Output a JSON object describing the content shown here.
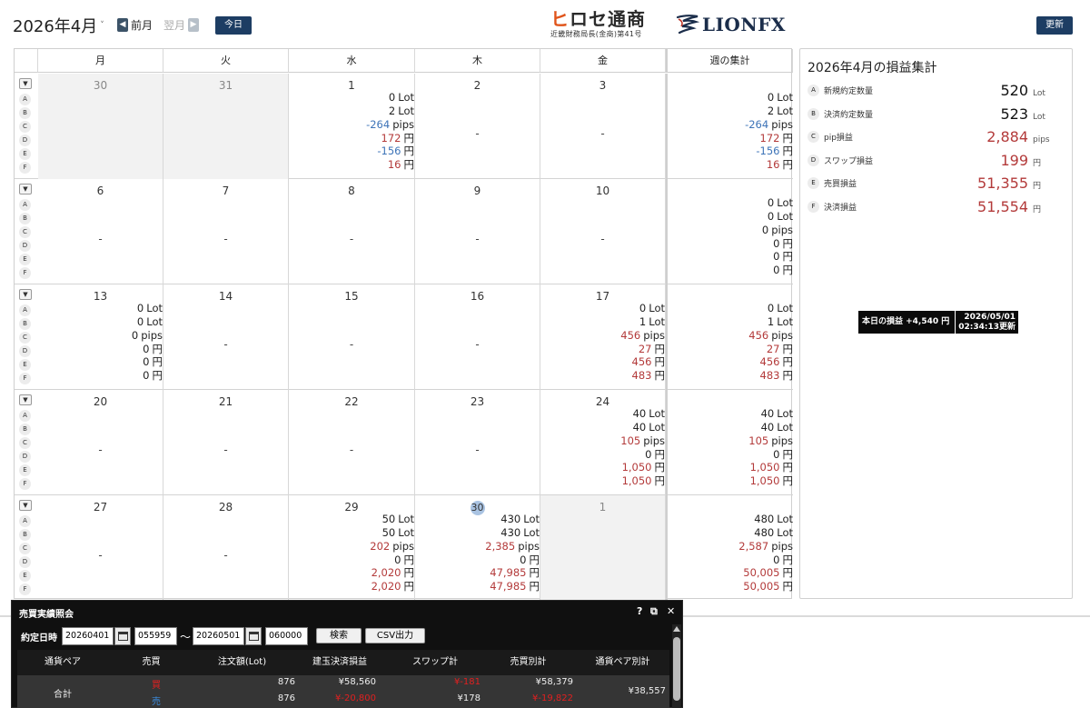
{
  "header": {
    "month_label": "2026年4月",
    "month_caret": "˅",
    "prev_label": "前月",
    "next_label": "翌月",
    "today_label": "今日",
    "refresh_label": "更新",
    "hirose_logo_name": "ヒロセ通商",
    "hirose_logo_sub": "近畿財務局長(金商)第41号",
    "lion_logo": "LIONFX"
  },
  "calendar": {
    "weekdays": [
      "月",
      "火",
      "水",
      "木",
      "金"
    ],
    "week_total_header": "週の集計",
    "row_letters": [
      "A",
      "B",
      "C",
      "D",
      "E",
      "F"
    ],
    "toggle_symbol": "▼",
    "units": [
      "Lot",
      "Lot",
      "pips",
      "円",
      "円",
      "円"
    ],
    "weeks": [
      {
        "days": [
          {
            "day": "30",
            "other_month": true,
            "values": null
          },
          {
            "day": "31",
            "other_month": true,
            "values": null
          },
          {
            "day": "1",
            "values": [
              "0",
              "2",
              "-264",
              "172",
              "-156",
              "16"
            ]
          },
          {
            "day": "2",
            "values": null
          },
          {
            "day": "3",
            "values": null
          }
        ],
        "total": [
          "0",
          "2",
          "-264",
          "172",
          "-156",
          "16"
        ]
      },
      {
        "days": [
          {
            "day": "6",
            "values": null
          },
          {
            "day": "7",
            "values": null
          },
          {
            "day": "8",
            "values": null
          },
          {
            "day": "9",
            "values": null
          },
          {
            "day": "10",
            "values": null
          }
        ],
        "total": [
          "0",
          "0",
          "0",
          "0",
          "0",
          "0"
        ]
      },
      {
        "days": [
          {
            "day": "13",
            "values": [
              "0",
              "0",
              "0",
              "0",
              "0",
              "0"
            ]
          },
          {
            "day": "14",
            "values": null
          },
          {
            "day": "15",
            "values": null
          },
          {
            "day": "16",
            "values": null
          },
          {
            "day": "17",
            "values": [
              "0",
              "1",
              "456",
              "27",
              "456",
              "483"
            ]
          }
        ],
        "total": [
          "0",
          "1",
          "456",
          "27",
          "456",
          "483"
        ]
      },
      {
        "days": [
          {
            "day": "20",
            "values": null
          },
          {
            "day": "21",
            "values": null
          },
          {
            "day": "22",
            "values": null
          },
          {
            "day": "23",
            "values": null
          },
          {
            "day": "24",
            "values": [
              "40",
              "40",
              "105",
              "0",
              "1,050",
              "1,050"
            ]
          }
        ],
        "total": [
          "40",
          "40",
          "105",
          "0",
          "1,050",
          "1,050"
        ]
      },
      {
        "days": [
          {
            "day": "27",
            "values": null
          },
          {
            "day": "28",
            "values": null
          },
          {
            "day": "29",
            "values": [
              "50",
              "50",
              "202",
              "0",
              "2,020",
              "2,020"
            ]
          },
          {
            "day": "30",
            "today": true,
            "values": [
              "430",
              "430",
              "2,385",
              "0",
              "47,985",
              "47,985"
            ]
          },
          {
            "day": "1",
            "other_month": true,
            "values": null
          }
        ],
        "total": [
          "480",
          "480",
          "2,587",
          "0",
          "50,005",
          "50,005"
        ]
      }
    ],
    "empty_mark": "-"
  },
  "summary": {
    "title": "2026年4月の損益集計",
    "rows": [
      {
        "letter": "A",
        "label": "新規約定数量",
        "value": "520",
        "unit": "Lot"
      },
      {
        "letter": "B",
        "label": "決済約定数量",
        "value": "523",
        "unit": "Lot"
      },
      {
        "letter": "C",
        "label": "pip損益",
        "value": "2,884",
        "unit": "pips"
      },
      {
        "letter": "D",
        "label": "スワップ損益",
        "value": "199",
        "unit": "円"
      },
      {
        "letter": "E",
        "label": "売買損益",
        "value": "51,355",
        "unit": "円"
      },
      {
        "letter": "F",
        "label": "決済損益",
        "value": "51,554",
        "unit": "円"
      }
    ],
    "badge_label": "本日の損益 +4,540 円",
    "badge_date": "2026/05/01",
    "badge_time": "02:34:13更新"
  },
  "trade_window": {
    "title": "売買実績照会",
    "icons": [
      "?",
      "⧉",
      "✕"
    ],
    "filter_label": "約定日時",
    "from_date": "20260401",
    "from_time": "055959",
    "tilde": "〜",
    "to_date": "20260501",
    "to_time": "060000",
    "search_label": "検索",
    "csv_label": "CSV出力",
    "columns": [
      "通貨ペア",
      "売買",
      "注文額(Lot)",
      "建玉決済損益",
      "スワップ計",
      "売買別計",
      "通貨ペア別計"
    ],
    "total_row": {
      "pair": "合計",
      "buy_label": "買",
      "sell_label": "売",
      "buy_amount": "876",
      "sell_amount": "876",
      "buy_pl": "¥58,560",
      "sell_pl": "¥-20,800",
      "buy_swap": "¥-181",
      "sell_swap": "¥178",
      "buy_subtotal": "¥58,379",
      "sell_subtotal": "¥-19,822",
      "pair_total": "¥38,557"
    }
  },
  "colors": {
    "accent_navy": "#1d3d63",
    "loss_blue": "#3e74b8",
    "profit_red": "#b33a3a",
    "hirose_orange": "#e0541a"
  }
}
